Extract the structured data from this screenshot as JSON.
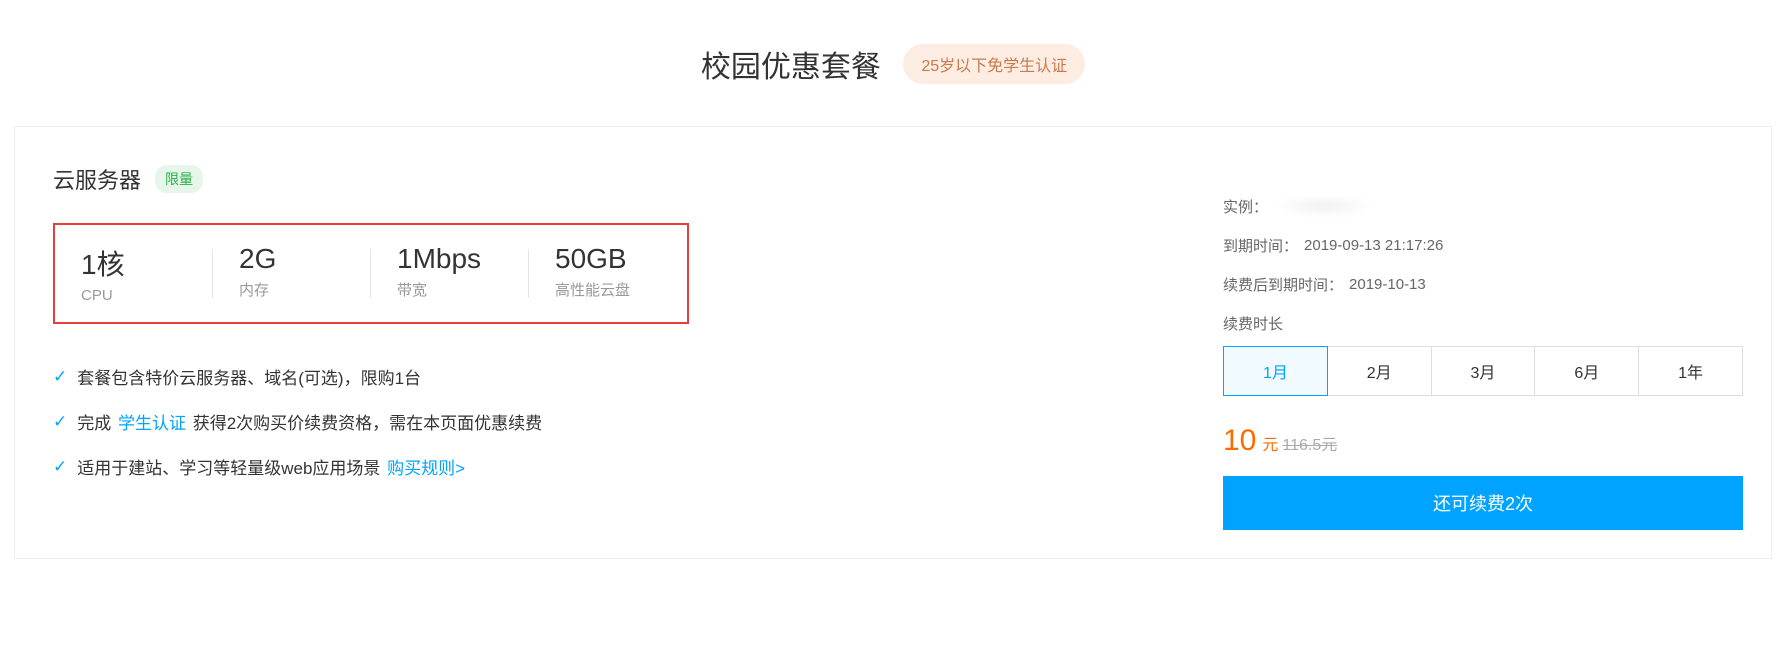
{
  "header": {
    "title": "校园优惠套餐",
    "age_badge": "25岁以下免学生认证"
  },
  "product": {
    "name": "云服务器",
    "limited_badge": "限量"
  },
  "specs": [
    {
      "value": "1核",
      "label": "CPU"
    },
    {
      "value": "2G",
      "label": "内存"
    },
    {
      "value": "1Mbps",
      "label": "带宽"
    },
    {
      "value": "50GB",
      "label": "高性能云盘"
    }
  ],
  "features": {
    "f1_text": "套餐包含特价云服务器、域名(可选)，限购1台",
    "f2_pre": "完成 ",
    "f2_link": "学生认证",
    "f2_post": " 获得2次购买价续费资格，需在本页面优惠续费",
    "f3_text": "适用于建站、学习等轻量级web应用场景 ",
    "f3_link": "购买规则>"
  },
  "right": {
    "instance_label": "实例：",
    "expire_label": "到期时间：",
    "expire_value": "2019-09-13 21:17:26",
    "after_renew_label": "续费后到期时间：",
    "after_renew_value": "2019-10-13",
    "duration_label": "续费时长",
    "durations": [
      "1月",
      "2月",
      "3月",
      "6月",
      "1年"
    ],
    "selected_index": 0,
    "price_number": "10",
    "price_unit": "元",
    "price_original": "116.5元",
    "renew_button": "还可续费2次"
  }
}
